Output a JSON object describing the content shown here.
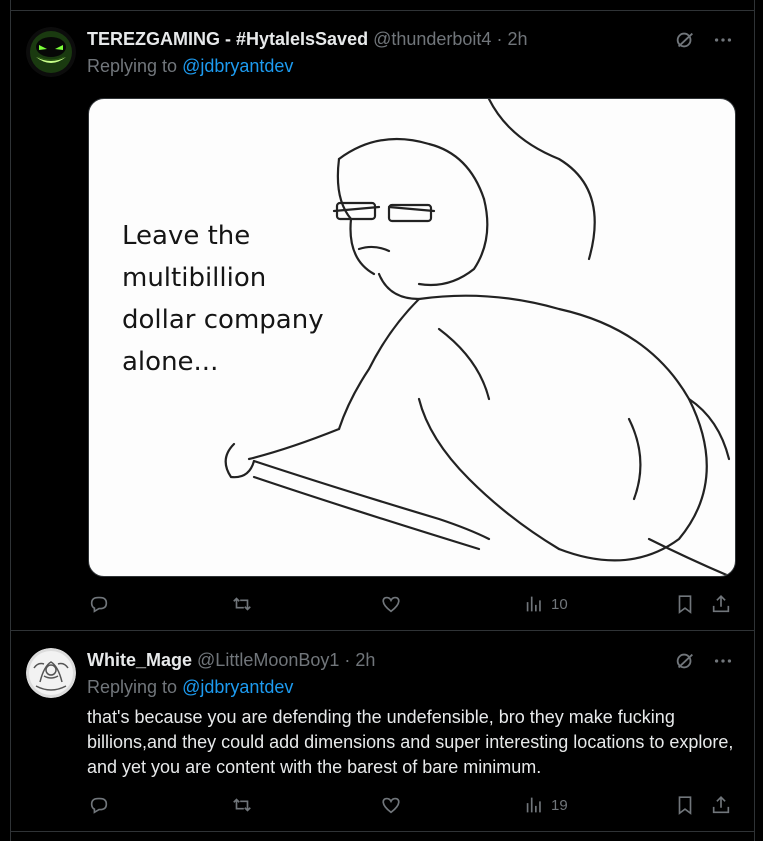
{
  "tweets": [
    {
      "display_name": "TEREZGAMING - #HytaleIsSaved",
      "handle": "@thunderboit4",
      "time": "2h",
      "replying_label": "Replying to ",
      "replying_to": "@jdbryantdev",
      "meme_text": "Leave the\nmultibillion\ndollar company\nalone...",
      "views": "10",
      "icons": [
        "grok-icon",
        "more-icon",
        "reply-icon",
        "retweet-icon",
        "like-icon",
        "views-icon",
        "bookmark-icon",
        "share-icon"
      ]
    },
    {
      "display_name": "White_Mage",
      "handle": "@LittleMoonBoy1",
      "time": "2h",
      "replying_label": "Replying to ",
      "replying_to": "@jdbryantdev",
      "body": "that's because you are defending the undefensible, bro they make fucking billions,and they could add dimensions and super interesting locations to explore, and yet you are content with the barest of bare minimum.",
      "views": "19"
    }
  ],
  "colors": {
    "accent": "#1d9bf0",
    "muted": "#71767b",
    "text": "#e7e9ea",
    "border": "#2f3336"
  }
}
